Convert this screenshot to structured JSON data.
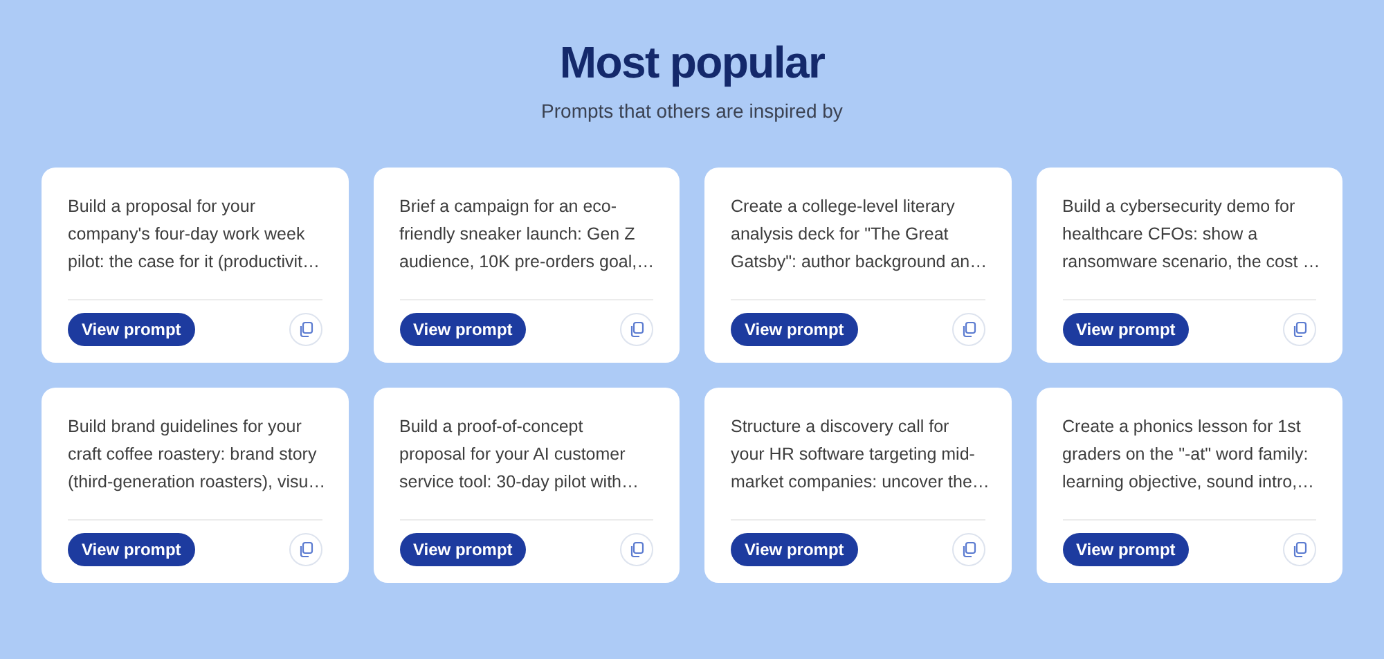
{
  "heading": "Most popular",
  "subheading": "Prompts that others are inspired by",
  "cards": [
    {
      "lines": [
        "Build a proposal for your",
        "company's four-day work week",
        "pilot: the case for it (productivit…"
      ],
      "button": "View prompt"
    },
    {
      "lines": [
        "Brief a campaign for an eco-",
        "friendly sneaker launch: Gen Z",
        "audience, 10K pre-orders goal,…"
      ],
      "button": "View prompt"
    },
    {
      "lines": [
        "Create a college-level literary",
        "analysis deck for \"The Great",
        "Gatsby\": author background an…"
      ],
      "button": "View prompt"
    },
    {
      "lines": [
        "Build a cybersecurity demo for",
        "healthcare CFOs: show a",
        "ransomware scenario, the cost …"
      ],
      "button": "View prompt"
    },
    {
      "lines": [
        "Build brand guidelines for your",
        "craft coffee roastery: brand story",
        "(third-generation roasters), visu…"
      ],
      "button": "View prompt"
    },
    {
      "lines": [
        "Build a proof-of-concept",
        "proposal for your AI customer",
        "service tool: 30-day pilot with…"
      ],
      "button": "View prompt"
    },
    {
      "lines": [
        "Structure a discovery call for",
        "your HR software targeting mid-",
        "market companies: uncover the…"
      ],
      "button": "View prompt"
    },
    {
      "lines": [
        "Create a phonics lesson for 1st",
        "graders on the \"-at\" word family:",
        "learning objective, sound intro,…"
      ],
      "button": "View prompt"
    }
  ]
}
